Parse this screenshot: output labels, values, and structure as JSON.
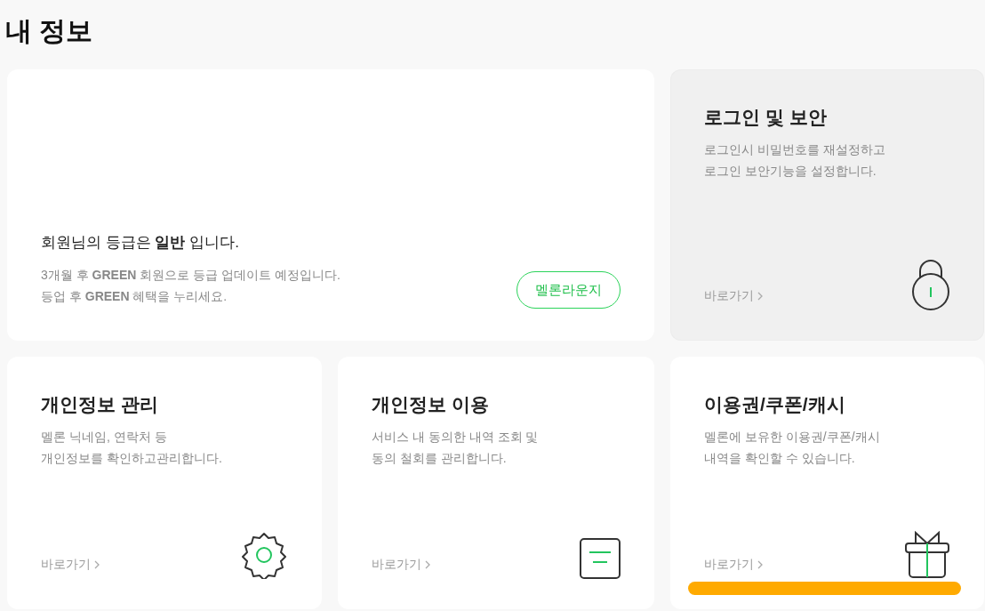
{
  "page_title": "내 정보",
  "membership": {
    "grade": "회원님의 등급은 **일반** 입니다.",
    "notes": [
      "3개월 후 **GREEN** 회원으로 등급 업데이트 예정입니다.",
      "등업 후 **GREEN** 혜택을 누리세요."
    ],
    "button": "멜론라운지"
  },
  "cards": [
    {
      "title": "로그인 및 보안",
      "description": [
        "로그인시 비밀번호를 재설정하고",
        "로그인 보안기능을 설정합니다."
      ],
      "link": "바로가기",
      "kind": "lock",
      "hovered": true
    },
    {
      "title": "개인정보 관리",
      "description": [
        "멜론 닉네임, 연락처 등",
        "개인정보를 확인하고관리합니다."
      ],
      "link": "바로가기",
      "kind": "gear",
      "hovered": false
    },
    {
      "title": "개인정보 이용",
      "description": [
        "서비스 내 동의한 내역 조회 및",
        "동의 철회를 관리합니다."
      ],
      "link": "바로가기",
      "kind": "document",
      "hovered": false
    },
    {
      "title": "이용권/쿠폰/캐시",
      "description": [
        "멜론에 보유한 이용권/쿠폰/캐시",
        "내역을 확인할 수 있습니다."
      ],
      "link": "바로가기",
      "kind": "gift",
      "hovered": false
    }
  ]
}
